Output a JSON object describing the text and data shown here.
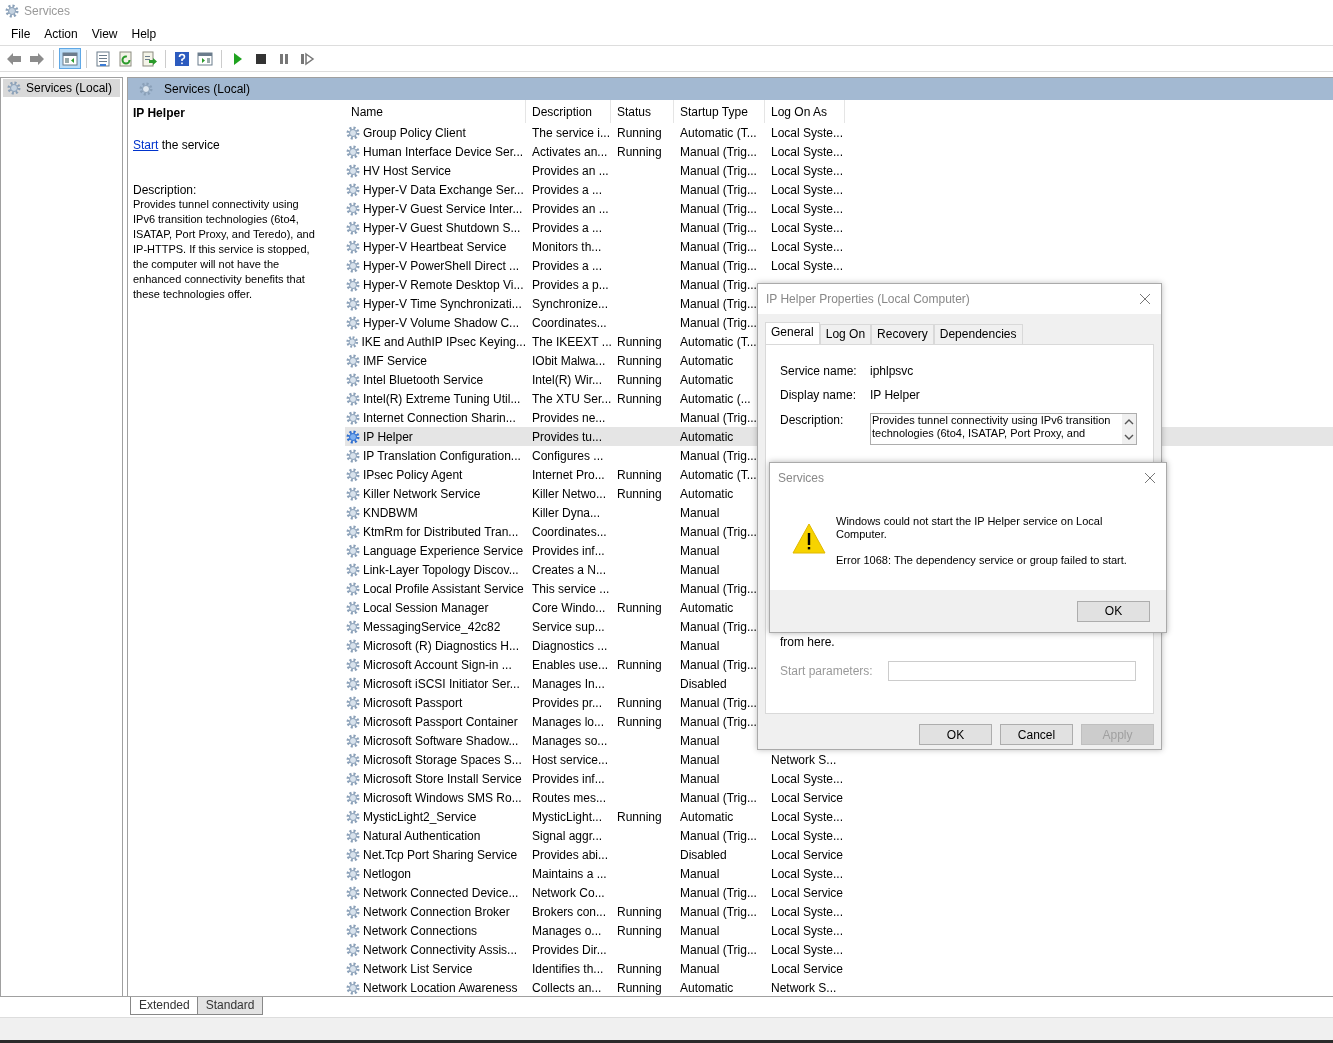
{
  "window": {
    "title": "Services"
  },
  "menu": [
    "File",
    "Action",
    "View",
    "Help"
  ],
  "toolbar": [
    [
      {
        "kind": "back",
        "on": false
      },
      {
        "kind": "forward",
        "on": false
      }
    ],
    [
      {
        "kind": "tree",
        "on": true
      }
    ],
    [
      {
        "kind": "properties",
        "on": false
      },
      {
        "kind": "refresh",
        "on": false
      },
      {
        "kind": "export",
        "on": false
      }
    ],
    [
      {
        "kind": "help",
        "on": false
      },
      {
        "kind": "view",
        "on": false
      }
    ],
    [
      {
        "kind": "start",
        "on": false
      },
      {
        "kind": "stop",
        "on": false
      },
      {
        "kind": "pause",
        "on": false
      },
      {
        "kind": "resume",
        "on": false
      }
    ]
  ],
  "tree": {
    "items": [
      {
        "label": "Services (Local)",
        "selected": true
      }
    ]
  },
  "pane_header": "Services (Local)",
  "detail": {
    "title": "IP Helper",
    "action_link": "Start",
    "action_rest": " the service",
    "description_label": "Description:",
    "description": "Provides tunnel connectivity using IPv6 transition technologies (6to4, ISATAP, Port Proxy, and Teredo), and IP-HTTPS. If this service is stopped, the computer will not have the enhanced connectivity benefits that these technologies offer."
  },
  "table": {
    "columns": [
      "Name",
      "Description",
      "Status",
      "Startup Type",
      "Log On As"
    ],
    "rows": [
      {
        "name": "Group Policy Client",
        "description": "The service i...",
        "status": "Running",
        "startup": "Automatic (T...",
        "logon": "Local Syste...",
        "selected": false
      },
      {
        "name": "Human Interface Device Ser...",
        "description": "Activates an...",
        "status": "Running",
        "startup": "Manual (Trig...",
        "logon": "Local Syste...",
        "selected": false
      },
      {
        "name": "HV Host Service",
        "description": "Provides an ...",
        "status": "",
        "startup": "Manual (Trig...",
        "logon": "Local Syste...",
        "selected": false
      },
      {
        "name": "Hyper-V Data Exchange Ser...",
        "description": "Provides a ...",
        "status": "",
        "startup": "Manual (Trig...",
        "logon": "Local Syste...",
        "selected": false
      },
      {
        "name": "Hyper-V Guest Service Inter...",
        "description": "Provides an ...",
        "status": "",
        "startup": "Manual (Trig...",
        "logon": "Local Syste...",
        "selected": false
      },
      {
        "name": "Hyper-V Guest Shutdown S...",
        "description": "Provides a ...",
        "status": "",
        "startup": "Manual (Trig...",
        "logon": "Local Syste...",
        "selected": false
      },
      {
        "name": "Hyper-V Heartbeat Service",
        "description": "Monitors th...",
        "status": "",
        "startup": "Manual (Trig...",
        "logon": "Local Syste...",
        "selected": false
      },
      {
        "name": "Hyper-V PowerShell Direct ...",
        "description": "Provides a ...",
        "status": "",
        "startup": "Manual (Trig...",
        "logon": "Local Syste...",
        "selected": false
      },
      {
        "name": "Hyper-V Remote Desktop Vi...",
        "description": "Provides a p...",
        "status": "",
        "startup": "Manual (Trig...",
        "selected": false
      },
      {
        "name": "Hyper-V Time Synchronizati...",
        "description": "Synchronize...",
        "status": "",
        "startup": "Manual (Trig...",
        "selected": false
      },
      {
        "name": "Hyper-V Volume Shadow C...",
        "description": "Coordinates...",
        "status": "",
        "startup": "Manual (Trig...",
        "selected": false
      },
      {
        "name": "IKE and AuthIP IPsec Keying...",
        "description": "The IKEEXT ...",
        "status": "Running",
        "startup": "Automatic (T...",
        "selected": false
      },
      {
        "name": "IMF Service",
        "description": "IObit Malwa...",
        "status": "Running",
        "startup": "Automatic",
        "selected": false
      },
      {
        "name": "Intel Bluetooth Service",
        "description": "Intel(R) Wir...",
        "status": "Running",
        "startup": "Automatic",
        "selected": false
      },
      {
        "name": "Intel(R) Extreme Tuning Util...",
        "description": "The XTU Ser...",
        "status": "Running",
        "startup": "Automatic (...",
        "selected": false
      },
      {
        "name": "Internet Connection Sharin...",
        "description": "Provides ne...",
        "status": "",
        "startup": "Manual (Trig...",
        "selected": false
      },
      {
        "name": "IP Helper",
        "description": "Provides tu...",
        "status": "",
        "startup": "Automatic",
        "selected": true
      },
      {
        "name": "IP Translation Configuration...",
        "description": "Configures ...",
        "status": "",
        "startup": "Manual (Trig...",
        "selected": false
      },
      {
        "name": "IPsec Policy Agent",
        "description": "Internet Pro...",
        "status": "Running",
        "startup": "Automatic (T...",
        "selected": false
      },
      {
        "name": "Killer Network Service",
        "description": "Killer Netwo...",
        "status": "Running",
        "startup": "Automatic",
        "selected": false
      },
      {
        "name": "KNDBWM",
        "description": "Killer Dyna...",
        "status": "",
        "startup": "Manual",
        "selected": false
      },
      {
        "name": "KtmRm for Distributed Tran...",
        "description": "Coordinates...",
        "status": "",
        "startup": "Manual (Trig...",
        "selected": false
      },
      {
        "name": "Language Experience Service",
        "description": "Provides inf...",
        "status": "",
        "startup": "Manual",
        "selected": false
      },
      {
        "name": "Link-Layer Topology Discov...",
        "description": "Creates a N...",
        "status": "",
        "startup": "Manual",
        "selected": false
      },
      {
        "name": "Local Profile Assistant Service",
        "description": "This service ...",
        "status": "",
        "startup": "Manual (Trig...",
        "selected": false
      },
      {
        "name": "Local Session Manager",
        "description": "Core Windo...",
        "status": "Running",
        "startup": "Automatic",
        "selected": false
      },
      {
        "name": "MessagingService_42c82",
        "description": "Service sup...",
        "status": "",
        "startup": "Manual (Trig...",
        "selected": false
      },
      {
        "name": "Microsoft (R) Diagnostics H...",
        "description": "Diagnostics ...",
        "status": "",
        "startup": "Manual",
        "selected": false
      },
      {
        "name": "Microsoft Account Sign-in ...",
        "description": "Enables use...",
        "status": "Running",
        "startup": "Manual (Trig...",
        "selected": false
      },
      {
        "name": "Microsoft iSCSI Initiator Ser...",
        "description": "Manages In...",
        "status": "",
        "startup": "Disabled",
        "selected": false
      },
      {
        "name": "Microsoft Passport",
        "description": "Provides pr...",
        "status": "Running",
        "startup": "Manual (Trig...",
        "selected": false
      },
      {
        "name": "Microsoft Passport Container",
        "description": "Manages lo...",
        "status": "Running",
        "startup": "Manual (Trig...",
        "selected": false
      },
      {
        "name": "Microsoft Software Shadow...",
        "description": "Manages so...",
        "status": "",
        "startup": "Manual",
        "selected": false
      },
      {
        "name": "Microsoft Storage Spaces S...",
        "description": "Host service...",
        "status": "",
        "startup": "Manual",
        "logon": "Network S...",
        "selected": false
      },
      {
        "name": "Microsoft Store Install Service",
        "description": "Provides inf...",
        "status": "",
        "startup": "Manual",
        "logon": "Local Syste...",
        "selected": false
      },
      {
        "name": "Microsoft Windows SMS Ro...",
        "description": "Routes mes...",
        "status": "",
        "startup": "Manual (Trig...",
        "logon": "Local Service",
        "selected": false
      },
      {
        "name": "MysticLight2_Service",
        "description": "MysticLight...",
        "status": "Running",
        "startup": "Automatic",
        "logon": "Local Syste...",
        "selected": false
      },
      {
        "name": "Natural Authentication",
        "description": "Signal aggr...",
        "status": "",
        "startup": "Manual (Trig...",
        "logon": "Local Syste...",
        "selected": false
      },
      {
        "name": "Net.Tcp Port Sharing Service",
        "description": "Provides abi...",
        "status": "",
        "startup": "Disabled",
        "logon": "Local Service",
        "selected": false
      },
      {
        "name": "Netlogon",
        "description": "Maintains a ...",
        "status": "",
        "startup": "Manual",
        "logon": "Local Syste...",
        "selected": false
      },
      {
        "name": "Network Connected Device...",
        "description": "Network Co...",
        "status": "",
        "startup": "Manual (Trig...",
        "logon": "Local Service",
        "selected": false
      },
      {
        "name": "Network Connection Broker",
        "description": "Brokers con...",
        "status": "Running",
        "startup": "Manual (Trig...",
        "logon": "Local Syste...",
        "selected": false
      },
      {
        "name": "Network Connections",
        "description": "Manages o...",
        "status": "Running",
        "startup": "Manual",
        "logon": "Local Syste...",
        "selected": false
      },
      {
        "name": "Network Connectivity Assis...",
        "description": "Provides Dir...",
        "status": "",
        "startup": "Manual (Trig...",
        "logon": "Local Syste...",
        "selected": false
      },
      {
        "name": "Network List Service",
        "description": "Identifies th...",
        "status": "Running",
        "startup": "Manual",
        "logon": "Local Service",
        "selected": false
      },
      {
        "name": "Network Location Awareness",
        "description": "Collects an...",
        "status": "Running",
        "startup": "Automatic",
        "logon": "Network S...",
        "selected": false
      }
    ]
  },
  "view_tabs": [
    {
      "label": "Extended",
      "selected": true
    },
    {
      "label": "Standard",
      "selected": false
    }
  ],
  "properties_dialog": {
    "title": "IP Helper Properties (Local Computer)",
    "tabs": [
      {
        "label": "General",
        "selected": true
      },
      {
        "label": "Log On",
        "selected": false
      },
      {
        "label": "Recovery",
        "selected": false
      },
      {
        "label": "Dependencies",
        "selected": false
      }
    ],
    "service_name_label": "Service name:",
    "service_name": "iphlpsvc",
    "display_name_label": "Display name:",
    "display_name": "IP Helper",
    "description_label": "Description:",
    "description_lines": [
      "Provides tunnel connectivity using IPv6 transition",
      "technologies (6to4, ISATAP, Port Proxy, and"
    ],
    "from_here": "from here.",
    "start_parameters": {
      "label": "Start parameters:",
      "disabled": true
    },
    "buttons": [
      {
        "label": "OK",
        "disabled": false
      },
      {
        "label": "Cancel",
        "disabled": false
      },
      {
        "label": "Apply",
        "disabled": true
      }
    ]
  },
  "message_box": {
    "title": "Services",
    "message": "Windows could not start the IP Helper service on Local Computer.",
    "error": "Error 1068: The dependency service or group failed to start.",
    "button": "OK"
  }
}
